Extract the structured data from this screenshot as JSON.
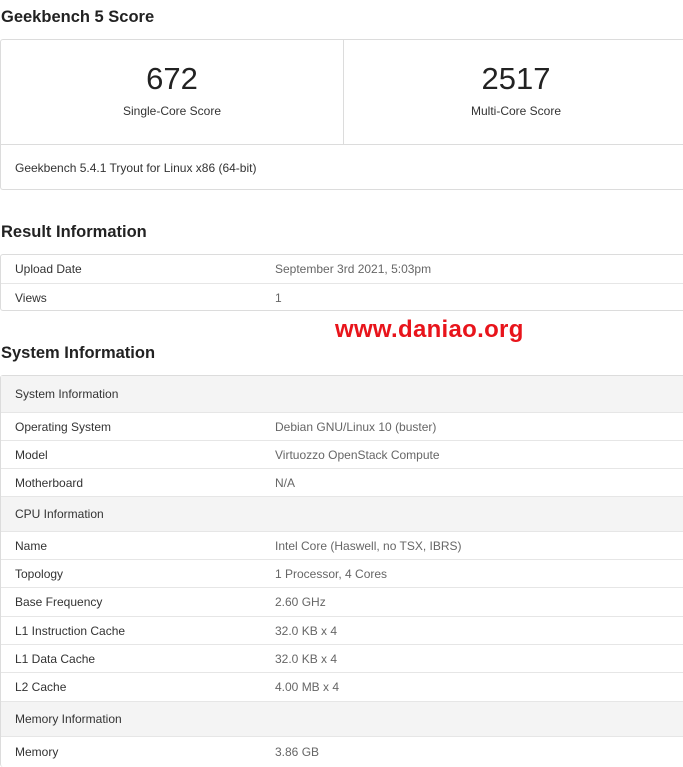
{
  "score_section": {
    "title": "Geekbench 5 Score",
    "single_core": {
      "value": "672",
      "label": "Single-Core Score"
    },
    "multi_core": {
      "value": "2517",
      "label": "Multi-Core Score"
    },
    "footer": "Geekbench 5.4.1 Tryout for Linux x86 (64-bit)"
  },
  "result_section": {
    "title": "Result Information",
    "rows": [
      {
        "key": "Upload Date",
        "value": "September 3rd 2021, 5:03pm"
      },
      {
        "key": "Views",
        "value": "1"
      }
    ]
  },
  "watermark": "www.daniao.org",
  "system_section": {
    "title": "System Information",
    "groups": [
      {
        "header": "System Information",
        "rows": [
          {
            "key": "Operating System",
            "value": "Debian GNU/Linux 10 (buster)"
          },
          {
            "key": "Model",
            "value": "Virtuozzo OpenStack Compute"
          },
          {
            "key": "Motherboard",
            "value": "N/A"
          }
        ]
      },
      {
        "header": "CPU Information",
        "rows": [
          {
            "key": "Name",
            "value": "Intel Core (Haswell, no TSX, IBRS)"
          },
          {
            "key": "Topology",
            "value": "1 Processor, 4 Cores"
          },
          {
            "key": "Base Frequency",
            "value": "2.60 GHz"
          },
          {
            "key": "L1 Instruction Cache",
            "value": "32.0 KB x 4"
          },
          {
            "key": "L1 Data Cache",
            "value": "32.0 KB x 4"
          },
          {
            "key": "L2 Cache",
            "value": "4.00 MB x 4"
          }
        ]
      },
      {
        "header": "Memory Information",
        "rows": [
          {
            "key": "Memory",
            "value": "3.86 GB"
          }
        ]
      }
    ]
  }
}
